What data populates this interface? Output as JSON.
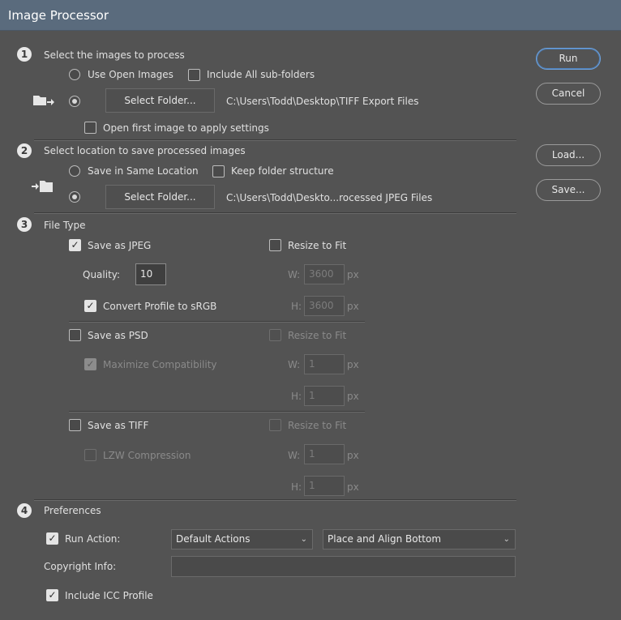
{
  "window": {
    "title": "Image Processor"
  },
  "buttons": {
    "run": "Run",
    "cancel": "Cancel",
    "load": "Load...",
    "save": "Save..."
  },
  "section1": {
    "number": "1",
    "title": "Select the images to process",
    "use_open_images": "Use Open Images",
    "include_subfolders": "Include All sub-folders",
    "select_folder": "Select Folder...",
    "folder_path": "C:\\Users\\Todd\\Desktop\\TIFF Export Files",
    "open_first": "Open first image to apply settings",
    "icon": "folder-open-arrow-icon"
  },
  "section2": {
    "number": "2",
    "title": "Select location to save processed images",
    "same_location": "Save in Same Location",
    "keep_structure": "Keep folder structure",
    "select_folder": "Select Folder...",
    "folder_path": "C:\\Users\\Todd\\Deskto...rocessed JPEG Files",
    "icon": "arrow-into-folder-icon"
  },
  "section3": {
    "number": "3",
    "title": "File Type",
    "jpeg": {
      "label": "Save as JPEG",
      "resize": "Resize to Fit",
      "quality_label": "Quality:",
      "quality_value": "10",
      "convert_profile": "Convert Profile to sRGB",
      "w_label": "W:",
      "w_value": "3600",
      "h_label": "H:",
      "h_value": "3600",
      "unit": "px"
    },
    "psd": {
      "label": "Save as PSD",
      "resize": "Resize to Fit",
      "maximize": "Maximize Compatibility",
      "w_label": "W:",
      "w_value": "1",
      "h_label": "H:",
      "h_value": "1",
      "unit": "px"
    },
    "tiff": {
      "label": "Save as TIFF",
      "resize": "Resize to Fit",
      "lzw": "LZW Compression",
      "w_label": "W:",
      "w_value": "1",
      "h_label": "H:",
      "h_value": "1",
      "unit": "px"
    }
  },
  "section4": {
    "number": "4",
    "title": "Preferences",
    "run_action": "Run Action:",
    "action_set": "Default Actions",
    "action": "Place and Align Bottom",
    "copyright_label": "Copyright Info:",
    "copyright_value": "",
    "include_icc": "Include ICC Profile"
  },
  "colors": {
    "background": "#535353",
    "titlebar": "#5a6b7d",
    "primary_border": "#6fa3de"
  }
}
